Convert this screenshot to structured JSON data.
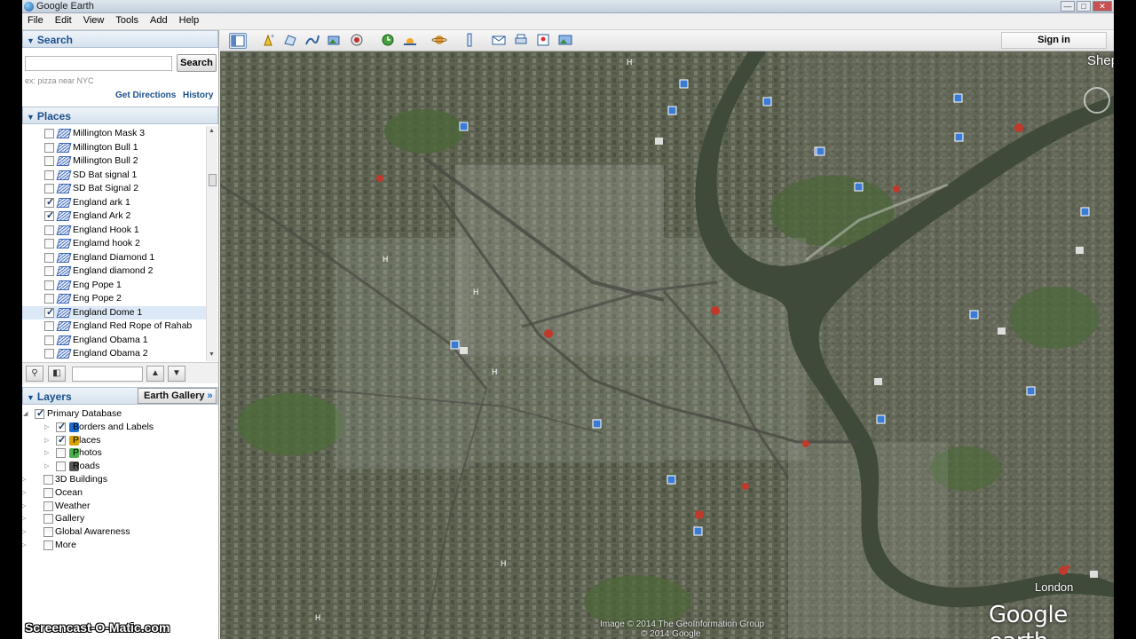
{
  "window": {
    "title": "Google Earth",
    "controls": [
      "—",
      "□",
      "✕"
    ]
  },
  "menu": [
    "File",
    "Edit",
    "View",
    "Tools",
    "Add",
    "Help"
  ],
  "search": {
    "header": "Search",
    "button": "Search",
    "placeholder": "",
    "hint": "ex: pizza near NYC",
    "get_directions": "Get Directions",
    "history": "History"
  },
  "places": {
    "header": "Places",
    "items": [
      {
        "label": "Millington Mask 3",
        "checked": false
      },
      {
        "label": "Millington Bull 1",
        "checked": false
      },
      {
        "label": "Millington Bull 2",
        "checked": false
      },
      {
        "label": "SD Bat signal 1",
        "checked": false
      },
      {
        "label": "SD  Bat Signal 2",
        "checked": false
      },
      {
        "label": "England ark 1",
        "checked": true
      },
      {
        "label": "England Ark 2",
        "checked": true
      },
      {
        "label": "England  Hook 1",
        "checked": false
      },
      {
        "label": "Englamd hook 2",
        "checked": false
      },
      {
        "label": "England Diamond 1",
        "checked": false
      },
      {
        "label": "England diamond 2",
        "checked": false
      },
      {
        "label": "Eng Pope 1",
        "checked": false
      },
      {
        "label": "Eng Pope 2",
        "checked": false
      },
      {
        "label": "England Dome 1",
        "checked": true,
        "selected": true
      },
      {
        "label": "England Red Rope of Rahab",
        "checked": false
      },
      {
        "label": "England Obama 1",
        "checked": false
      },
      {
        "label": "England Obama 2",
        "checked": false
      }
    ]
  },
  "layers": {
    "header": "Layers",
    "earth_gallery": "Earth Gallery",
    "items": [
      {
        "label": "Primary Database",
        "checked": true,
        "level": 0
      },
      {
        "label": "Borders and Labels",
        "checked": true,
        "level": 1
      },
      {
        "label": "Places",
        "checked": true,
        "level": 1
      },
      {
        "label": "Photos",
        "checked": false,
        "level": 1
      },
      {
        "label": "Roads",
        "checked": false,
        "level": 1
      },
      {
        "label": "3D Buildings",
        "checked": false,
        "level": 0
      },
      {
        "label": "Ocean",
        "checked": false,
        "level": 0
      },
      {
        "label": "Weather",
        "checked": false,
        "level": 0
      },
      {
        "label": "Gallery",
        "checked": false,
        "level": 0
      },
      {
        "label": "Global Awareness",
        "checked": false,
        "level": 0
      },
      {
        "label": "More",
        "checked": false,
        "level": 0
      }
    ]
  },
  "toolbar": {
    "signin": "Sign in"
  },
  "map": {
    "labels": {
      "shepherds": "Sheph",
      "london": "London"
    },
    "copyright_1": "Image © 2014 The GeoInformation Group",
    "copyright_2": "© 2014 Google",
    "logo": "Google earth"
  },
  "watermark": "Screencast-O-Matic.com",
  "colors": {
    "accent": "#1b4f8b",
    "river": "#3f4a3a"
  }
}
